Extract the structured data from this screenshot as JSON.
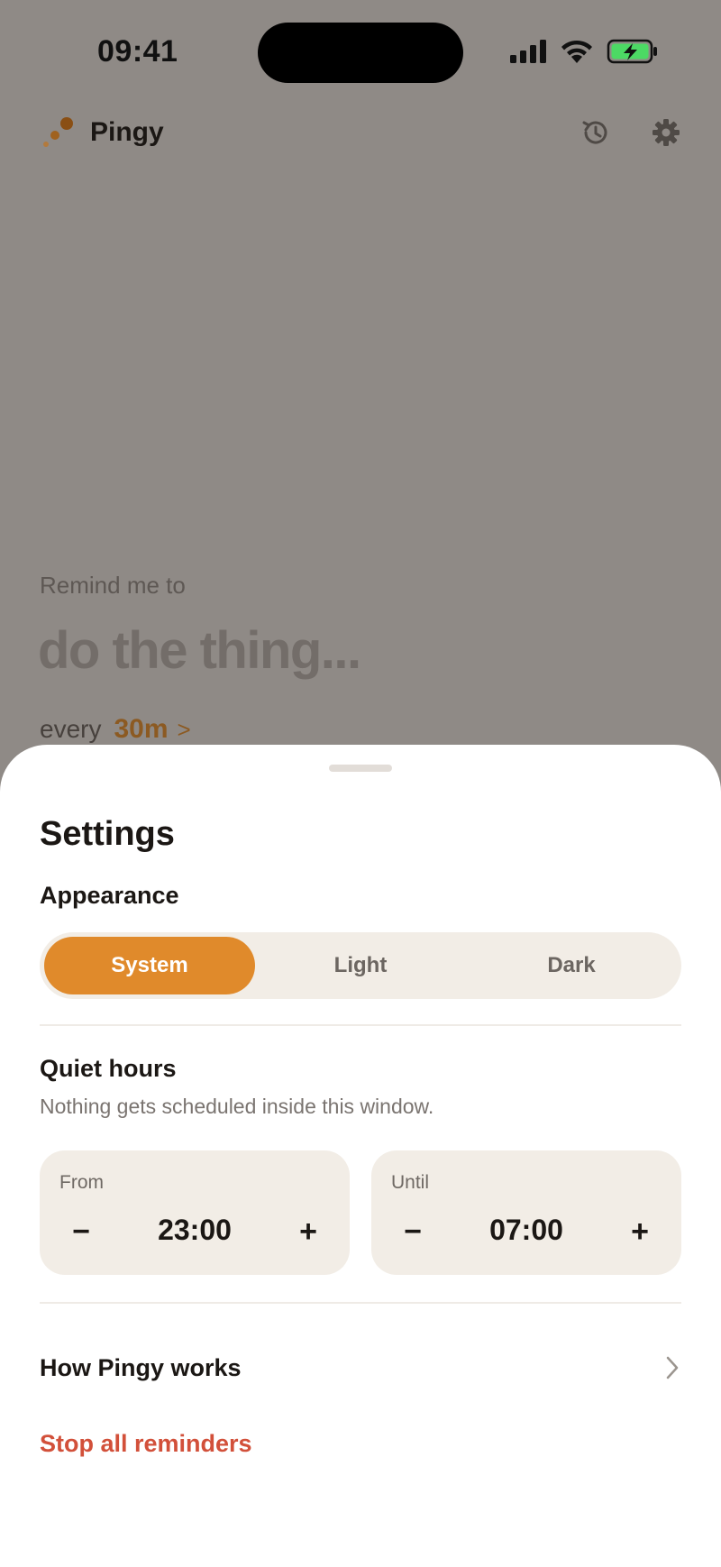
{
  "status_bar": {
    "time": "09:41"
  },
  "app": {
    "name": "Pingy"
  },
  "header": {
    "history_icon": "history-icon",
    "settings_icon": "gear-icon"
  },
  "main": {
    "remind_label": "Remind me to",
    "task_placeholder": "do the thing...",
    "every_label": "every",
    "interval": "30m",
    "interval_chevron": ">"
  },
  "settings": {
    "title": "Settings",
    "appearance": {
      "title": "Appearance",
      "options": [
        "System",
        "Light",
        "Dark"
      ],
      "selected": "System"
    },
    "quiet_hours": {
      "title": "Quiet hours",
      "subtitle": "Nothing gets scheduled inside this window.",
      "from": {
        "label": "From",
        "value": "23:00"
      },
      "until": {
        "label": "Until",
        "value": "07:00"
      },
      "minus": "−",
      "plus": "+"
    },
    "how_it_works": "How Pingy works",
    "stop_all": "Stop all reminders"
  },
  "colors": {
    "accent": "#e08a2b",
    "danger": "#d2503a",
    "battery": "#4cd964"
  }
}
